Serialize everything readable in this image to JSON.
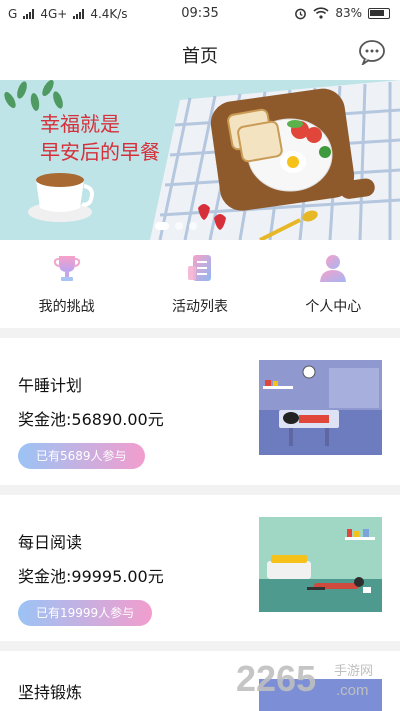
{
  "status_bar": {
    "network_left": "G",
    "network": "4G+",
    "speed": "4.4K/s",
    "time": "09:35",
    "battery": "83%"
  },
  "header": {
    "title": "首页",
    "message_icon": "chat-bubble-icon"
  },
  "banner": {
    "line1": "幸福就是",
    "line2": "早安后的早餐",
    "slides": 3,
    "active_slide": 1
  },
  "nav": {
    "items": [
      {
        "label": "我的挑战",
        "icon": "trophy-icon"
      },
      {
        "label": "活动列表",
        "icon": "list-icon"
      },
      {
        "label": "个人中心",
        "icon": "user-icon"
      }
    ]
  },
  "cards": [
    {
      "title": "午睡计划",
      "pool": "奖金池:56890.00元",
      "badge": "已有5689人参与"
    },
    {
      "title": "每日阅读",
      "pool": "奖金池:99995.00元",
      "badge": "已有19999人参与"
    },
    {
      "title": "坚持锻炼"
    }
  ],
  "watermark": {
    "number": "2265",
    "suffix": "手游网",
    "domain": ".com"
  }
}
